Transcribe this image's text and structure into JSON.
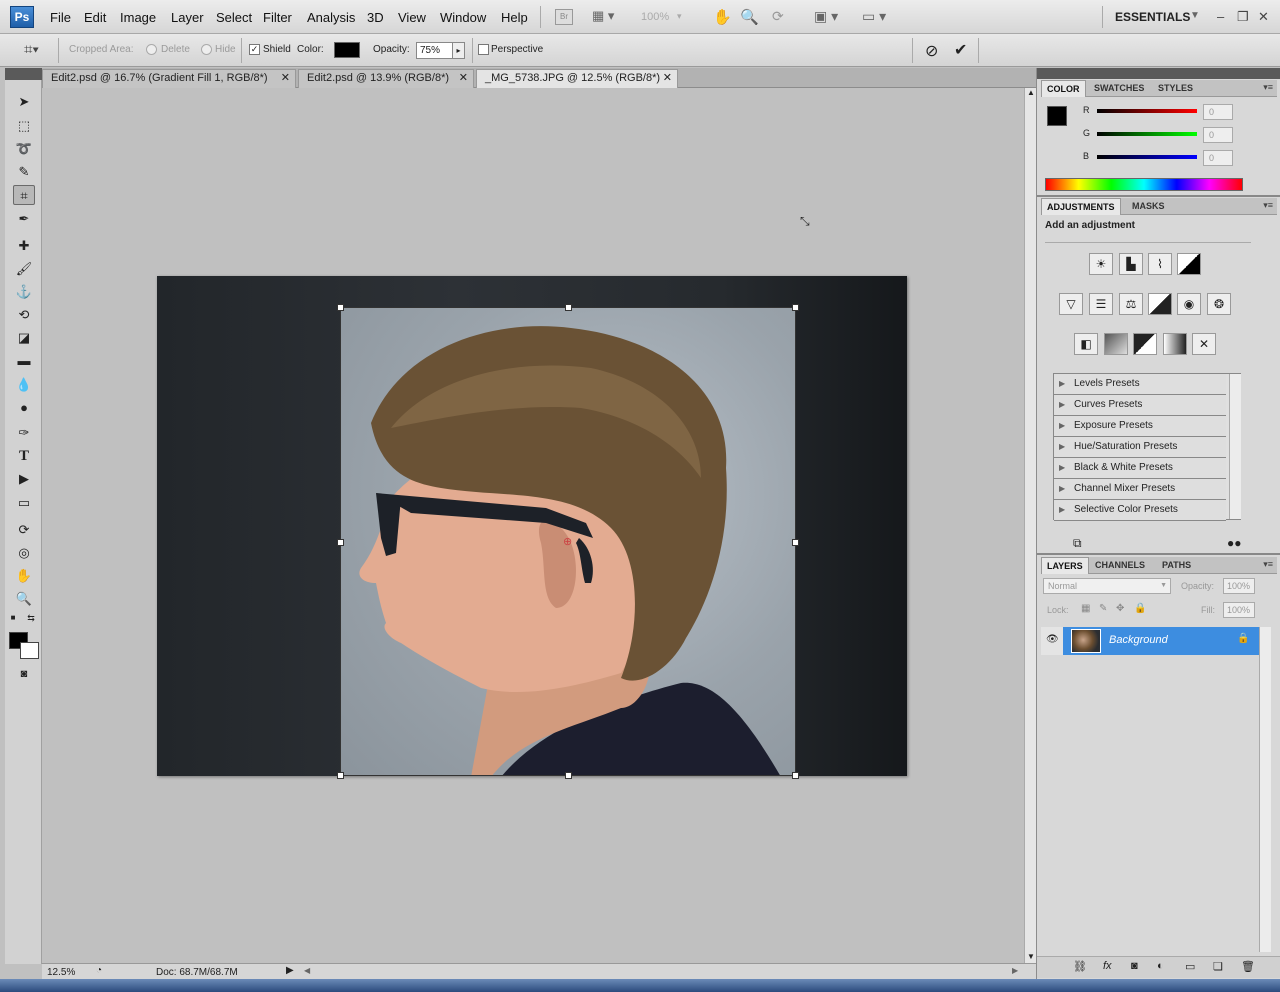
{
  "app": {
    "logo": "Ps"
  },
  "menu": [
    "File",
    "Edit",
    "Image",
    "Layer",
    "Select",
    "Filter",
    "Analysis",
    "3D",
    "View",
    "Window",
    "Help"
  ],
  "menubar": {
    "bridge": "Br",
    "zoom": "100%",
    "workspace": "ESSENTIALS"
  },
  "options": {
    "cropped_area_label": "Cropped Area:",
    "delete_label": "Delete",
    "hide_label": "Hide",
    "shield_label": "Shield",
    "color_label": "Color:",
    "opacity_label": "Opacity:",
    "opacity_value": "75%",
    "perspective_label": "Perspective",
    "shield_color": "#000000"
  },
  "tabs": [
    {
      "label": "Edit2.psd @ 16.7% (Gradient Fill 1, RGB/8*)",
      "active": false
    },
    {
      "label": "Edit2.psd @ 13.9% (RGB/8*)",
      "active": false
    },
    {
      "label": "_MG_5738.JPG @ 12.5% (RGB/8*)",
      "active": true
    }
  ],
  "status": {
    "zoom": "12.5%",
    "doc": "Doc: 68.7M/68.7M"
  },
  "color_panel": {
    "tabs": [
      "COLOR",
      "SWATCHES",
      "STYLES"
    ],
    "r_label": "R",
    "g_label": "G",
    "b_label": "B",
    "r": "0",
    "g": "0",
    "b": "0"
  },
  "adjustments": {
    "tabs": [
      "ADJUSTMENTS",
      "MASKS"
    ],
    "title": "Add an adjustment",
    "presets": [
      "Levels Presets",
      "Curves Presets",
      "Exposure Presets",
      "Hue/Saturation Presets",
      "Black & White Presets",
      "Channel Mixer Presets",
      "Selective Color Presets"
    ]
  },
  "layers": {
    "tabs": [
      "LAYERS",
      "CHANNELS",
      "PATHS"
    ],
    "blend_mode": "Normal",
    "opacity_label": "Opacity:",
    "opacity_value": "100%",
    "lock_label": "Lock:",
    "fill_label": "Fill:",
    "fill_value": "100%",
    "layer_name": "Background"
  }
}
